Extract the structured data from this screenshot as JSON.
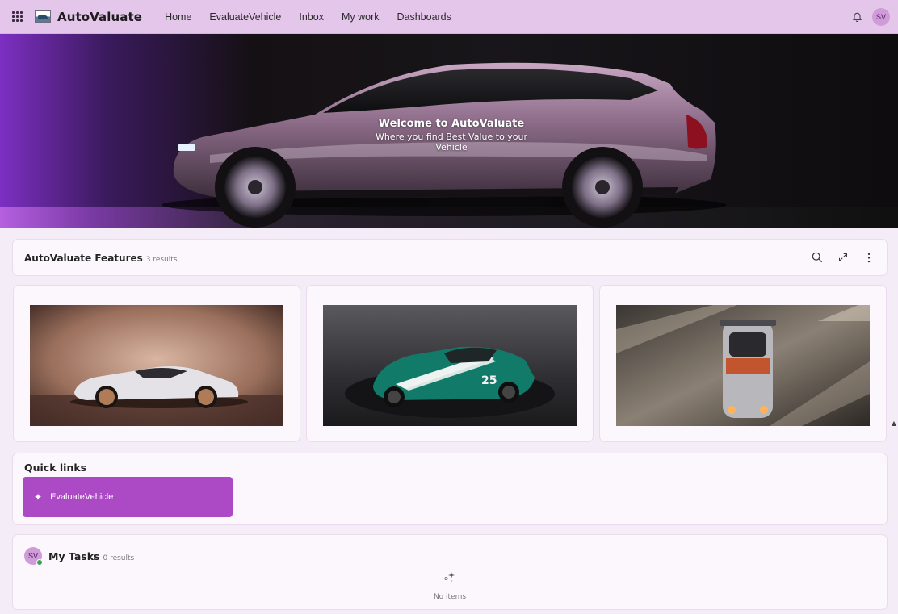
{
  "topbar": {
    "app_title": "AutoValuate",
    "nav": [
      "Home",
      "EvaluateVehicle",
      "Inbox",
      "My work",
      "Dashboards"
    ],
    "user_initials": "SV",
    "icons": {
      "menu": "waffle-grid-icon",
      "notifications": "bell-icon"
    }
  },
  "hero": {
    "title": "Welcome to AutoValuate",
    "subtitle": "Where you find Best Value to your Vehicle"
  },
  "features": {
    "title": "AutoValuate Features",
    "count": "3 results",
    "icons": [
      "search-icon",
      "expand-icon",
      "more-vertical-icon"
    ]
  },
  "quick_links": {
    "title": "Quick links",
    "items": [
      {
        "label": "EvaluateVehicle",
        "icon": "sparkle-icon"
      }
    ]
  },
  "tasks": {
    "title": "My Tasks",
    "count": "0 results",
    "user_initials": "SV",
    "empty_text": "No items"
  },
  "colors": {
    "topbar": "#e3c6ea",
    "accent": "#ac49c4",
    "page_bg": "#f4ecf6",
    "presence": "#2fa84f"
  }
}
